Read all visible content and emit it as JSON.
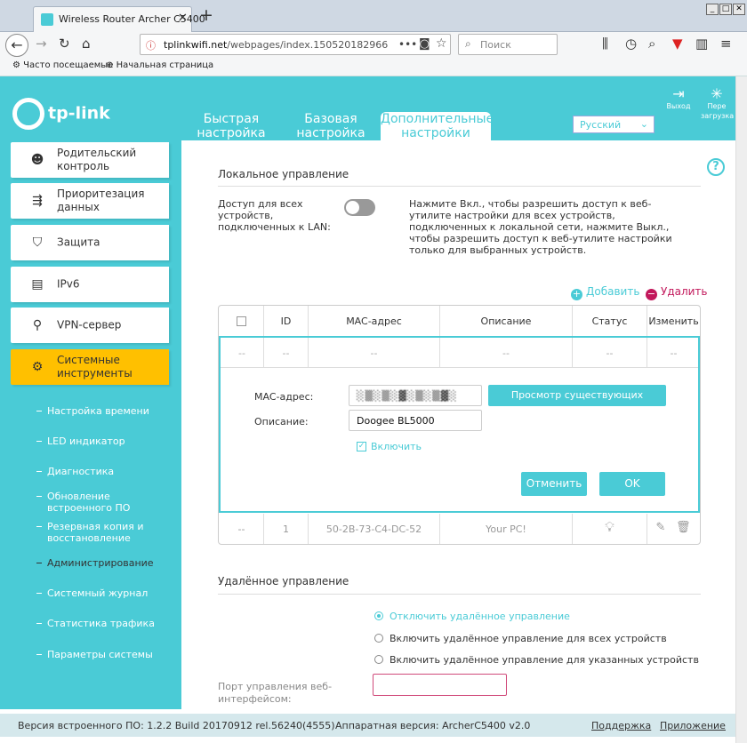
{
  "browser": {
    "tab_title": "Wireless Router Archer C5400",
    "url_host": "tplinkwifi.net",
    "url_path": "/webpages/index.150520182966",
    "search_placeholder": "Поиск",
    "bookmarks": [
      "Часто посещаемые",
      "Начальная страница"
    ]
  },
  "header": {
    "logo": "tp-link",
    "tabs": [
      {
        "label": "Быстрая настройка"
      },
      {
        "label": "Базовая настройка"
      },
      {
        "label": "Дополнительные настройки"
      }
    ],
    "language": "Русский",
    "logout_label": "Выход",
    "reboot_label": "Пере загрузка"
  },
  "sidebar": {
    "items": [
      {
        "label": "Родительский контроль",
        "icon": "family-icon"
      },
      {
        "label": "Приоритезация данных",
        "icon": "priority-icon"
      },
      {
        "label": "Защита",
        "icon": "shield-icon"
      },
      {
        "label": "IPv6",
        "icon": "ipv6-icon"
      },
      {
        "label": "VPN-сервер",
        "icon": "vpn-icon"
      },
      {
        "label": "Системные инструменты",
        "icon": "gear-icon"
      }
    ],
    "subitems": [
      "Настройка времени",
      "LED индикатор",
      "Диагностика",
      "Обновление встроенного ПО",
      "Резервная копия и восстановление",
      "Администрирование",
      "Системный журнал",
      "Статистика трафика",
      "Параметры системы"
    ]
  },
  "local": {
    "title": "Локальное управление",
    "access_label": "Доступ для всех устройств, подключенных к LAN:",
    "access_on": false,
    "description": "Нажмите Вкл., чтобы разрешить доступ к веб-утилите настройки для всех устройств, подключенных к локальной сети, нажмите Выкл., чтобы разрешить доступ к веб-утилите настройки только для выбранных устройств.",
    "add_label": "Добавить",
    "delete_label": "Удалить",
    "columns": [
      "ID",
      "MAC-адрес",
      "Описание",
      "Статус",
      "Изменить"
    ],
    "empty_row": [
      "--",
      "--",
      "--",
      "--",
      "--",
      "--"
    ],
    "edit": {
      "mac_label": "MAC-адрес:",
      "desc_label": "Описание:",
      "desc_value": "Doogee BL5000",
      "view_devices": "Просмотр существующих устройств",
      "enable_label": "Включить",
      "enabled": true,
      "cancel": "Отменить",
      "ok": "OK"
    },
    "rows": [
      {
        "check": "--",
        "id": "1",
        "mac": "50-2B-73-C4-DC-52",
        "desc": "Your PC!"
      }
    ]
  },
  "remote": {
    "title": "Удалённое управление",
    "options": [
      "Отключить удалённое управление",
      "Включить удалённое управление для всех устройств",
      "Включить удалённое управление для указанных устройств"
    ],
    "selected": 0,
    "port_label": "Порт управления веб-интерфейсом:"
  },
  "footer": {
    "firmware": "Версия встроенного ПО: 1.2.2 Build 20170912 rel.56240(4555)",
    "hardware": "Аппаратная версия: ArcherC5400 v2.0",
    "support": "Поддержка",
    "app": "Приложение"
  },
  "colors": {
    "accent": "#4acbd6",
    "active_menu": "#ffc000",
    "delete": "#c2185b"
  }
}
